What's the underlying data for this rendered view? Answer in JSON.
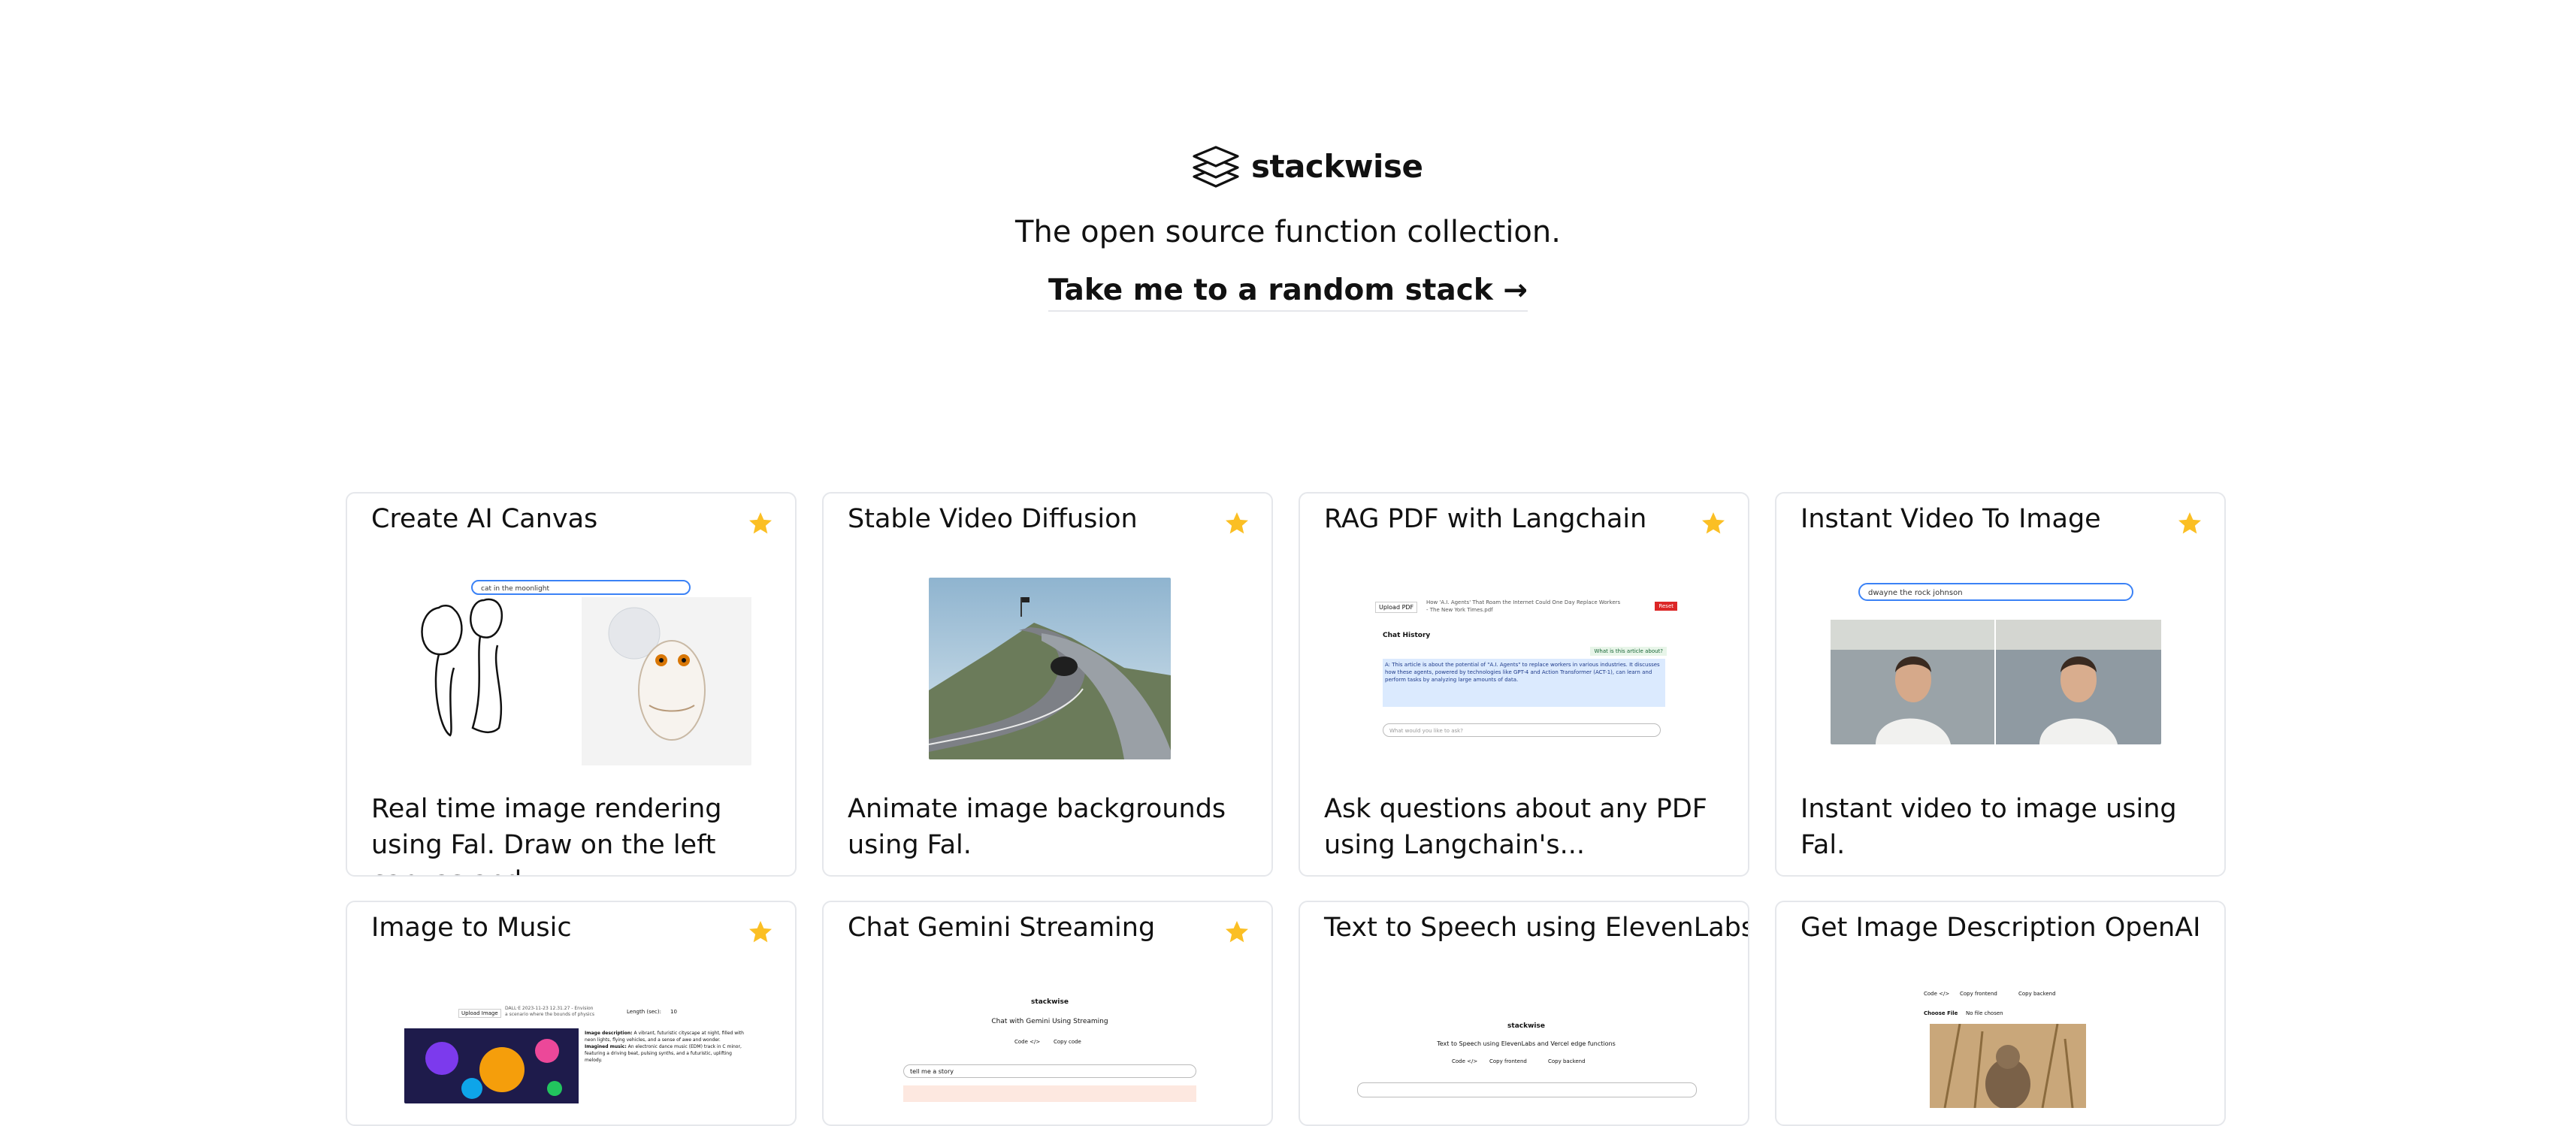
{
  "header": {
    "logo_text": "stackwise",
    "tagline": "The open source function collection.",
    "random_link": "Take me to a random stack →"
  },
  "colors": {
    "star": "#fbbf24",
    "border": "#e5e7eb",
    "text": "#111111"
  },
  "cards": [
    {
      "title": "Create AI Canvas",
      "starred": true,
      "description": "Real time image rendering using Fal. Draw on the left canvas and...",
      "thumb_text": "cat in the moonlight"
    },
    {
      "title": "Stable Video Diffusion",
      "starred": true,
      "description": "Animate image backgrounds using Fal."
    },
    {
      "title": "RAG PDF with Langchain",
      "starred": true,
      "description": "Ask questions about any PDF using Langchain's...",
      "thumb": {
        "upload": "Upload PDF",
        "file": "How 'A.I. Agents' That Roam the Internet Could One Day Replace Workers - The New York Times.pdf",
        "reset": "Reset",
        "history": "Chat History",
        "question": "What is this article about?",
        "answer": "A: This article is about the potential of \"A.I. Agents\" to replace workers in various industries. It discusses how these agents, powered by technologies like GPT-4 and Action Transformer (ACT-1), can learn and perform tasks by analyzing large amounts of data.",
        "placeholder": "What would you like to ask?"
      }
    },
    {
      "title": "Instant Video To Image",
      "starred": true,
      "description": "Instant video to image using Fal.",
      "thumb_text": "dwayne the rock johnson"
    },
    {
      "title": "Image to Music",
      "starred": true,
      "description": "",
      "thumb": {
        "upload": "Upload Image",
        "file": "DALL·E 2023-11-23 12.31.27 - Envision a scenario where the bounds of physics are...",
        "length": "Length (sec):",
        "length_value": "10",
        "desc_label": "Image description:",
        "desc": "A vibrant, futuristic cityscape at night, filled with neon lights, flying vehicles, and a sense of awe and wonder.",
        "music_label": "Imagined music:",
        "music": "An electronic dance music (EDM) track in C minor, featuring a driving beat, pulsing synths, and a futuristic, uplifting melody."
      }
    },
    {
      "title": "Chat Gemini Streaming",
      "starred": true,
      "description": "",
      "thumb": {
        "logo": "stackwise",
        "heading": "Chat with Gemini Using Streaming",
        "code": "Code </>",
        "copy": "Copy code",
        "input": "tell me a story"
      }
    },
    {
      "title": "Text to Speech using ElevenLabs",
      "starred": false,
      "description": "",
      "thumb": {
        "logo": "stackwise",
        "heading": "Text to Speech using ElevenLabs and Vercel edge functions",
        "code": "Code </>",
        "copy_frontend": "Copy frontend",
        "copy_backend": "Copy backend"
      }
    },
    {
      "title": "Get Image Description OpenAI",
      "starred": false,
      "description": "",
      "thumb": {
        "code": "Code </>",
        "copy_frontend": "Copy frontend",
        "copy_backend": "Copy backend",
        "choose": "Choose File",
        "nofile": "No file chosen"
      }
    }
  ]
}
